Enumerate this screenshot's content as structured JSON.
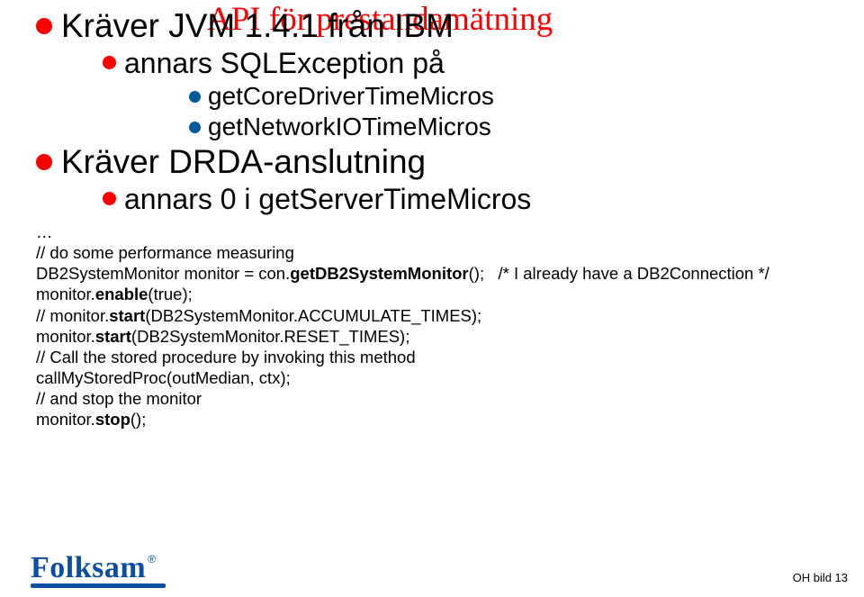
{
  "title": "API för prestandamätning",
  "bullets": {
    "b1": "Kräver JVM 1.4.1 från IBM",
    "b1_1": "annars SQLException på",
    "b1_1_1": "getCoreDriverTimeMicros",
    "b1_1_2": "getNetworkIOTimeMicros",
    "b2": "Kräver DRDA-anslutning",
    "b2_1": "annars 0 i getServerTimeMicros"
  },
  "code": {
    "l1": "…",
    "l2": "// do some performance measuring",
    "l3a": "DB2SystemMonitor monitor = con.",
    "l3b": "getDB2SystemMonitor",
    "l3c": "();   /* I already have a DB2Connection */",
    "l4a": "monitor.",
    "l4b": "enable",
    "l4c": "(true);",
    "l5a": "// monitor.",
    "l5b": "start",
    "l5c": "(DB2SystemMonitor.ACCUMULATE_TIMES);",
    "l6a": "monitor.",
    "l6b": "start",
    "l6c": "(DB2SystemMonitor.RESET_TIMES);",
    "l7": "// Call the stored procedure by invoking this method",
    "l8": "callMyStoredProc(outMedian, ctx);",
    "l9": "// and stop the monitor",
    "l10a": "monitor.",
    "l10b": "stop",
    "l10c": "();"
  },
  "footer": {
    "page": "OH bild 13",
    "brand": "Folksam",
    "reg": "®"
  }
}
